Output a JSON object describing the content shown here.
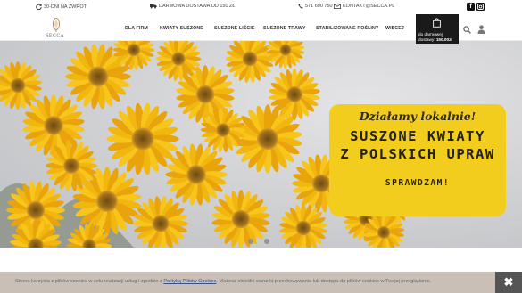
{
  "topbar": {
    "returns": "30-DNI NA ZWROT",
    "delivery": "DARMOWA DOSTAWA OD 150 ZŁ",
    "phone": "571 600 750",
    "email": "KONTAKT@SECCA.PL"
  },
  "logo": {
    "text": "SECCA"
  },
  "nav": {
    "items": [
      {
        "label": "DLA FIRM"
      },
      {
        "label": "KWIATY SUSZONE"
      },
      {
        "label": "SUSZONE LIŚCIE"
      },
      {
        "label": "SUSZONE TRAWY"
      },
      {
        "label": "STABILIZOWANE ROŚLINY"
      },
      {
        "label": "WIĘCEJ"
      }
    ]
  },
  "cart": {
    "line1": "do darmowej",
    "line2_prefix": "dostawy: ",
    "amount": "150.00zł"
  },
  "hero": {
    "subtitle": "Działamy lokalnie!",
    "title_line1": "SUSZONE KWIATY",
    "title_line2": "Z POLSKICH UPRAW",
    "cta": "SPRAWDZAM!",
    "slides_total": 3,
    "active_slide": 2
  },
  "cookie": {
    "text_before": "Strona korzysta z plików cookies w celu realizacji usług i zgodnie z ",
    "link": "Polityką Plików Cookies",
    "text_after": ". Możesz określić warunki przechowywania lub dostępu do plików cookies w Twojej przeglądarce.",
    "close": "✖"
  },
  "colors": {
    "promo_yellow": "#f3cd1e",
    "flower_yellow": "#f2b70f",
    "cart_dark": "#1a1a1a",
    "cookie_bg": "#c9bfb6",
    "cookie_close_bg": "#555555"
  }
}
